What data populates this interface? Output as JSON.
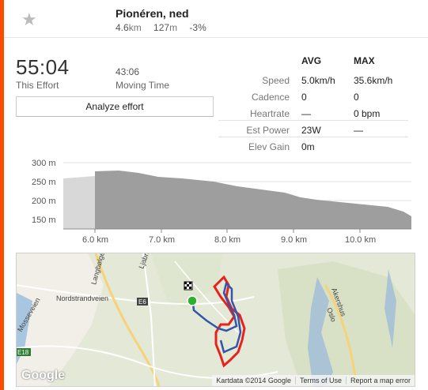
{
  "segment": {
    "name": "Pionéren, ned",
    "distance": "4.6",
    "distance_unit": "km",
    "elevation": "127",
    "elevation_unit": "m",
    "grade": "-3%"
  },
  "effort": {
    "time": "55:04",
    "time_label": "This Effort",
    "moving_time": "43:06",
    "moving_label": "Moving Time",
    "analyze_label": "Analyze effort"
  },
  "stats": {
    "avg_header": "AVG",
    "max_header": "MAX",
    "rows": [
      {
        "label": "Speed",
        "avg": "5.0km/h",
        "max": "35.6km/h"
      },
      {
        "label": "Cadence",
        "avg": "0",
        "max": "0"
      },
      {
        "label": "Heartrate",
        "avg": "—",
        "max": "0 bpm"
      },
      {
        "label": "Est Power",
        "avg": "23W",
        "max": "—"
      },
      {
        "label": "Elev Gain",
        "avg": "0m",
        "max": ""
      }
    ]
  },
  "elevation_chart": {
    "y_ticks": [
      "300 m",
      "250 m",
      "200 m",
      "150 m"
    ],
    "x_ticks": [
      "6.0 km",
      "7.0 km",
      "8.0 km",
      "9.0 km",
      "10.0 km"
    ]
  },
  "map": {
    "labels": [
      "Nordstrandveien",
      "Mosseveien",
      "Langbølgen",
      "E6",
      "E18",
      "Akershus",
      "Oslo",
      "Ljabruvegen"
    ],
    "google": "Google",
    "attribution": "Kartdata ©2014 Google",
    "terms": "Terms of Use",
    "report": "Report a map error"
  },
  "colors": {
    "accent": "#fc4c02",
    "route": "#e8221b",
    "effort_route": "#3355aa"
  }
}
